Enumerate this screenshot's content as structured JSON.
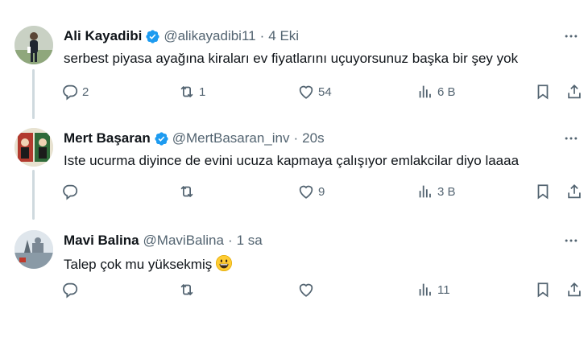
{
  "tweets": [
    {
      "name": "Ali Kayadibi",
      "verified": true,
      "handle": "@alikayadibi11",
      "dot": "·",
      "time": "4 Eki",
      "text": "serbest piyasa ayağına kiraları ev fiyatlarını uçuyorsunuz başka bir şey yok",
      "replies": "2",
      "retweets": "1",
      "likes": "54",
      "views": "6 B"
    },
    {
      "name": "Mert Başaran",
      "verified": true,
      "handle": "@MertBasaran_inv",
      "dot": "·",
      "time": "20s",
      "text": "Iste ucurma diyince de evini ucuza kapmaya çalışıyor emlakcilar diyo laaaa",
      "replies": "",
      "retweets": "",
      "likes": "9",
      "views": "3 B"
    },
    {
      "name": "Mavi Balina",
      "verified": false,
      "handle": "@MaviBalina",
      "dot": "·",
      "time": "1 sa",
      "text": "Talep çok mu yüksekmiş",
      "emoji": "grinning-face",
      "replies": "",
      "retweets": "",
      "likes": "",
      "views": "11"
    }
  ],
  "colors": {
    "text": "#0f1419",
    "secondary": "#536471",
    "verified": "#1d9bf0",
    "thread_line": "#cfd9de"
  }
}
